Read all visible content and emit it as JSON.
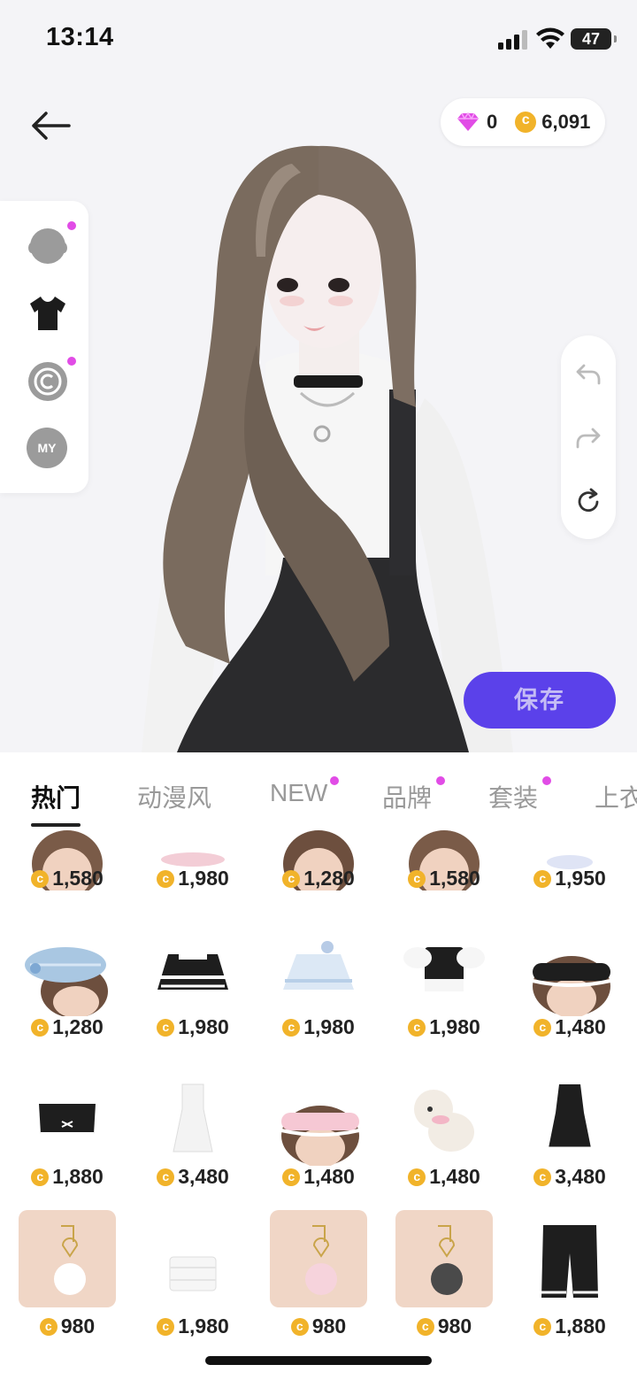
{
  "status_bar": {
    "time": "13:14",
    "battery": "47"
  },
  "wallet": {
    "gems": "0",
    "coins": "6,091"
  },
  "sidebar": {
    "items": [
      {
        "name": "face",
        "badge": true
      },
      {
        "name": "clothing",
        "badge": false
      },
      {
        "name": "creator",
        "badge": true
      },
      {
        "name": "my",
        "label": "MY",
        "badge": false
      }
    ]
  },
  "actions": {
    "save_label": "保存"
  },
  "tabs": [
    {
      "label": "热门",
      "active": true,
      "badge": false
    },
    {
      "label": "动漫风",
      "active": false,
      "badge": false
    },
    {
      "label": "NEW",
      "active": false,
      "badge": true
    },
    {
      "label": "品牌",
      "active": false,
      "badge": true
    },
    {
      "label": "套装",
      "active": false,
      "badge": true
    },
    {
      "label": "上衣",
      "active": false,
      "badge": false
    }
  ],
  "items": [
    {
      "price": "1,580"
    },
    {
      "price": "1,980"
    },
    {
      "price": "1,280"
    },
    {
      "price": "1,580"
    },
    {
      "price": "1,950"
    },
    {
      "price": "1,280"
    },
    {
      "price": "1,980"
    },
    {
      "price": "1,980"
    },
    {
      "price": "1,980"
    },
    {
      "price": "1,480"
    },
    {
      "price": "1,880"
    },
    {
      "price": "3,480"
    },
    {
      "price": "1,480"
    },
    {
      "price": "1,480"
    },
    {
      "price": "3,480"
    },
    {
      "price": "980"
    },
    {
      "price": "1,980"
    },
    {
      "price": "980"
    },
    {
      "price": "980"
    },
    {
      "price": "1,880"
    }
  ],
  "colors": {
    "accent": "#5b41ea",
    "badge": "#e14ce6",
    "coin": "#f1b32a"
  }
}
